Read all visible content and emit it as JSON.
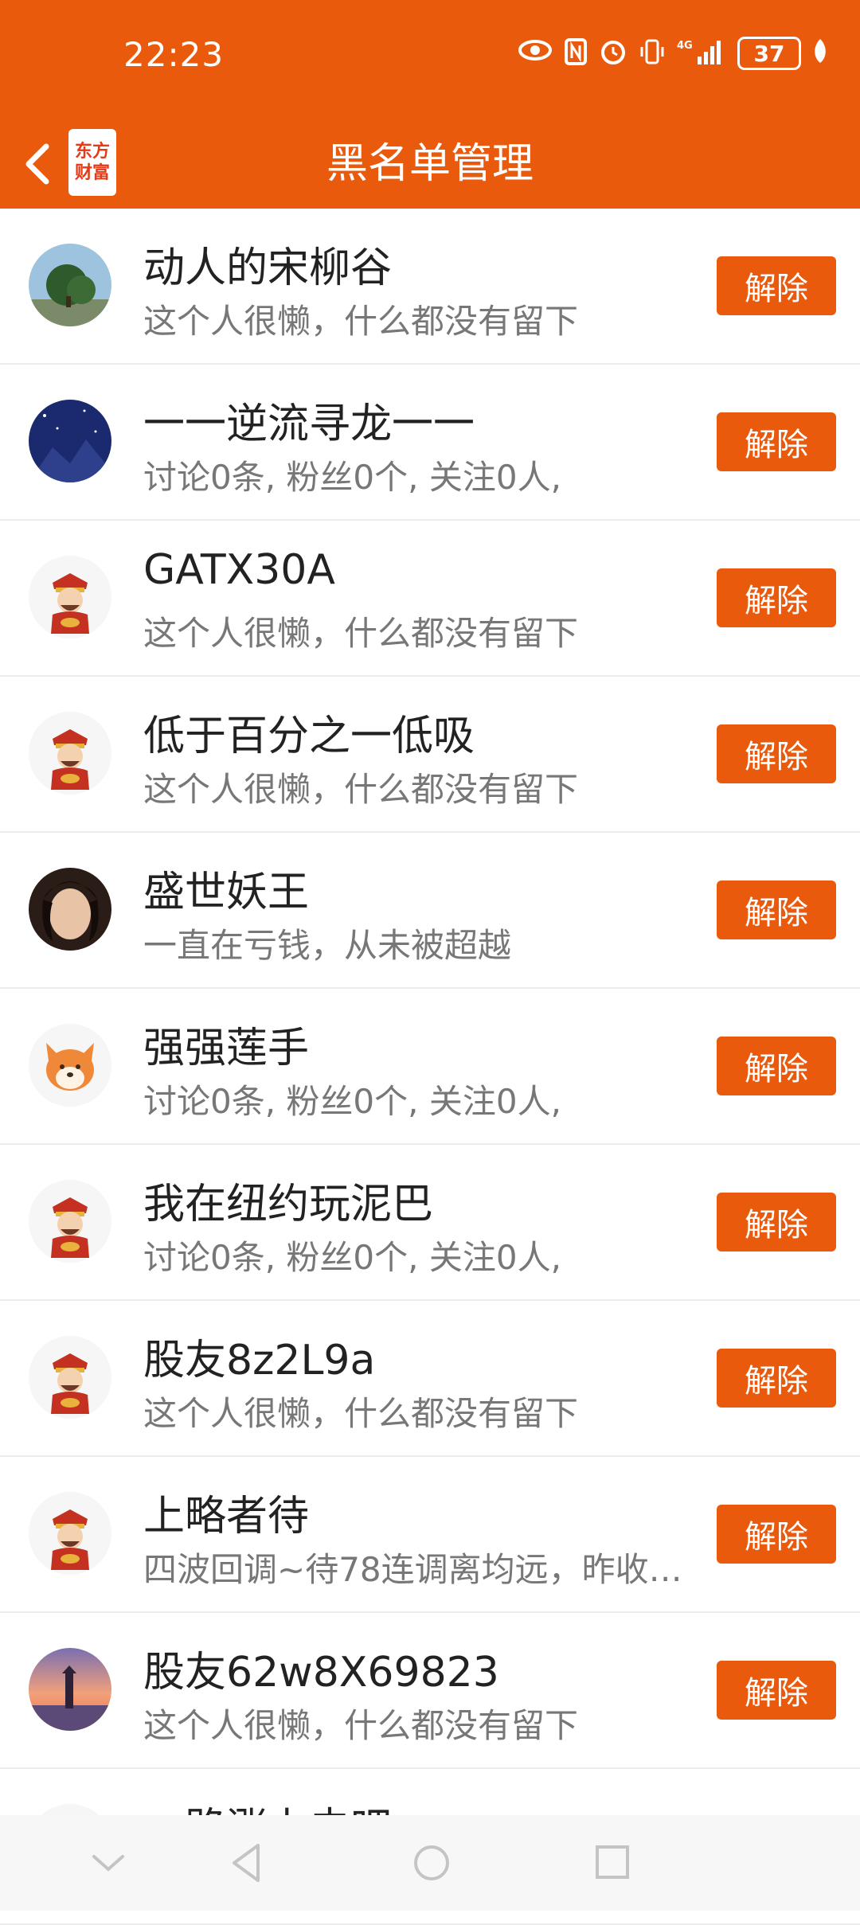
{
  "status_bar": {
    "time": "22:23",
    "battery": "37",
    "network": "4G"
  },
  "header": {
    "title": "黑名单管理",
    "logo_line1": "东方",
    "logo_line2": "财富",
    "accent_color": "#e95a0c"
  },
  "remove_label": "解除",
  "users": [
    {
      "name": "动人的宋柳谷",
      "desc": "这个人很懒，什么都没有留下",
      "avatar": "landscape-tree"
    },
    {
      "name": "一一逆流寻龙一一",
      "desc": "讨论0条, 粉丝0个, 关注0人,",
      "avatar": "night-sky"
    },
    {
      "name": "GATX30A",
      "desc": "这个人很懒，什么都没有留下",
      "avatar": "fortune-god"
    },
    {
      "name": "低于百分之一低吸",
      "desc": "这个人很懒，什么都没有留下",
      "avatar": "fortune-god"
    },
    {
      "name": "盛世妖王",
      "desc": "一直在亏钱，从未被超越",
      "avatar": "portrait-photo"
    },
    {
      "name": "强强莲手",
      "desc": "讨论0条, 粉丝0个, 关注0人,",
      "avatar": "dog"
    },
    {
      "name": "我在纽约玩泥巴",
      "desc": "讨论0条, 粉丝0个, 关注0人,",
      "avatar": "fortune-god"
    },
    {
      "name": "股友8z2L9a",
      "desc": "这个人很懒，什么都没有留下",
      "avatar": "fortune-god"
    },
    {
      "name": "上略者待",
      "desc": "四波回调~待78连调离均远，昨收…",
      "avatar": "fortune-god"
    },
    {
      "name": "股友62w8X69823",
      "desc": "这个人很懒，什么都没有留下",
      "avatar": "sunset-lighthouse"
    },
    {
      "name": "一路涨上去吧",
      "desc": "",
      "avatar": "fortune-god"
    }
  ]
}
